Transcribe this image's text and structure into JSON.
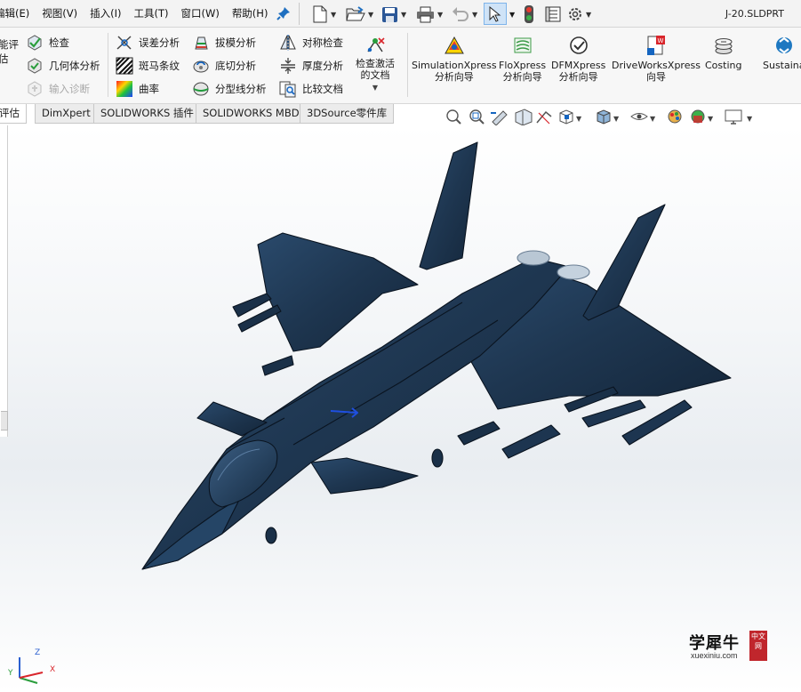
{
  "menubar": {
    "items": [
      "编辑(E)",
      "视图(V)",
      "插入(I)",
      "工具(T)",
      "窗口(W)",
      "帮助(H)"
    ],
    "document_title": "J-20.SLDPRT"
  },
  "ribbon": {
    "group_evaluate": {
      "partial_label_line1": "能评",
      "partial_label_line2": "估",
      "check": "检查",
      "geometry_analysis": "几何体分析",
      "import_diagnostics": "输入诊断"
    },
    "group_analysis": {
      "deviation_analysis": "误差分析",
      "zebra_stripes": "斑马条纹",
      "curvature": "曲率",
      "draft_analysis": "拔模分析",
      "undercut_analysis": "底切分析",
      "parting_line_analysis": "分型线分析",
      "symmetry_check": "对称检查",
      "thickness_analysis": "厚度分析",
      "compare_documents": "比较文档"
    },
    "check_active_doc_line1": "检查激活",
    "check_active_doc_line2": "的文档",
    "wizards": [
      {
        "line1": "SimulationXpress",
        "line2": "分析向导"
      },
      {
        "line1": "FloXpress",
        "line2": "分析向导"
      },
      {
        "line1": "DFMXpress",
        "line2": "分析向导"
      },
      {
        "line1": "DriveWorksXpress",
        "line2": "向导"
      },
      {
        "line1": "Costing",
        "line2": ""
      },
      {
        "line1": "Sustaina",
        "line2": ""
      }
    ]
  },
  "tabs": [
    {
      "label": "评估",
      "active": true
    },
    {
      "label": "DimXpert",
      "active": false
    },
    {
      "label": "SOLIDWORKS 插件",
      "active": false
    },
    {
      "label": "SOLIDWORKS MBD",
      "active": false
    },
    {
      "label": "3DSource零件库",
      "active": false
    }
  ],
  "triad": {
    "x": "X",
    "y": "Y",
    "z": "Z"
  },
  "watermark": {
    "cn": "学犀牛",
    "url": "xuexiniu.com",
    "seal": "中文网"
  },
  "colors": {
    "model": "#1e3650",
    "accent_red": "#d9262c",
    "accent_blue": "#1565c0"
  }
}
